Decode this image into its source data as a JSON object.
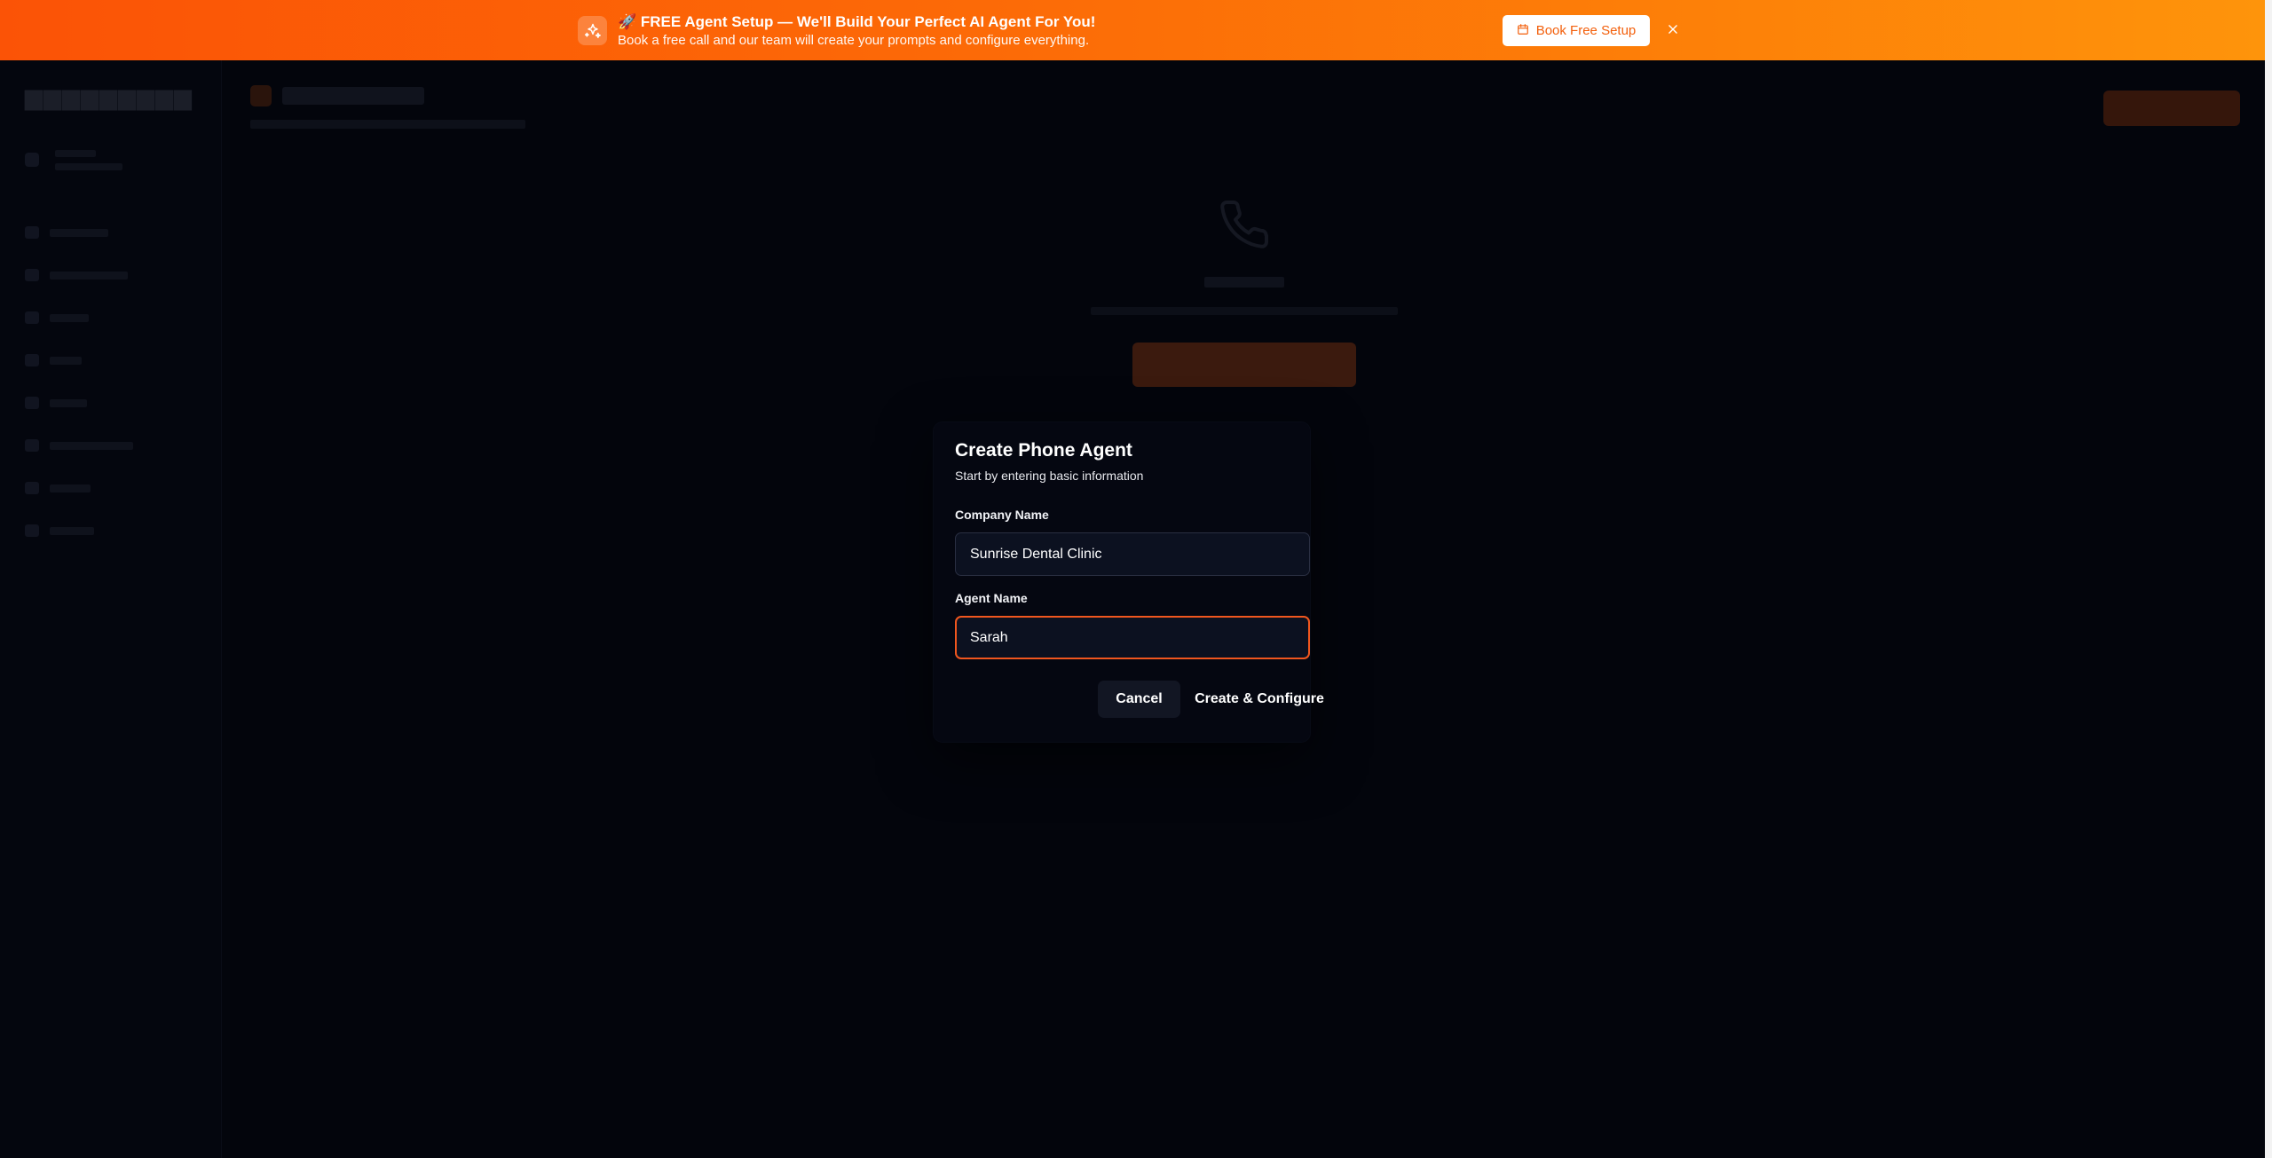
{
  "banner": {
    "title": "🚀 FREE Agent Setup — We'll Build Your Perfect AI Agent For You!",
    "subtitle": "Book a free call and our team will create your prompts and configure everything.",
    "cta_label": "Book Free Setup",
    "icon": "sparkles-icon",
    "close_icon": "close-icon"
  },
  "modal": {
    "title": "Create Phone Agent",
    "subtitle": "Start by entering basic information",
    "company_label": "Company Name",
    "company_value": "Sunrise Dental Clinic",
    "agent_label": "Agent Name",
    "agent_value": "Sarah",
    "cancel_label": "Cancel",
    "create_label": "Create & Configure"
  },
  "colors": {
    "accent": "#f0561e",
    "banner_start": "#fb5306",
    "banner_end": "#fe940b",
    "background": "#03050c"
  }
}
